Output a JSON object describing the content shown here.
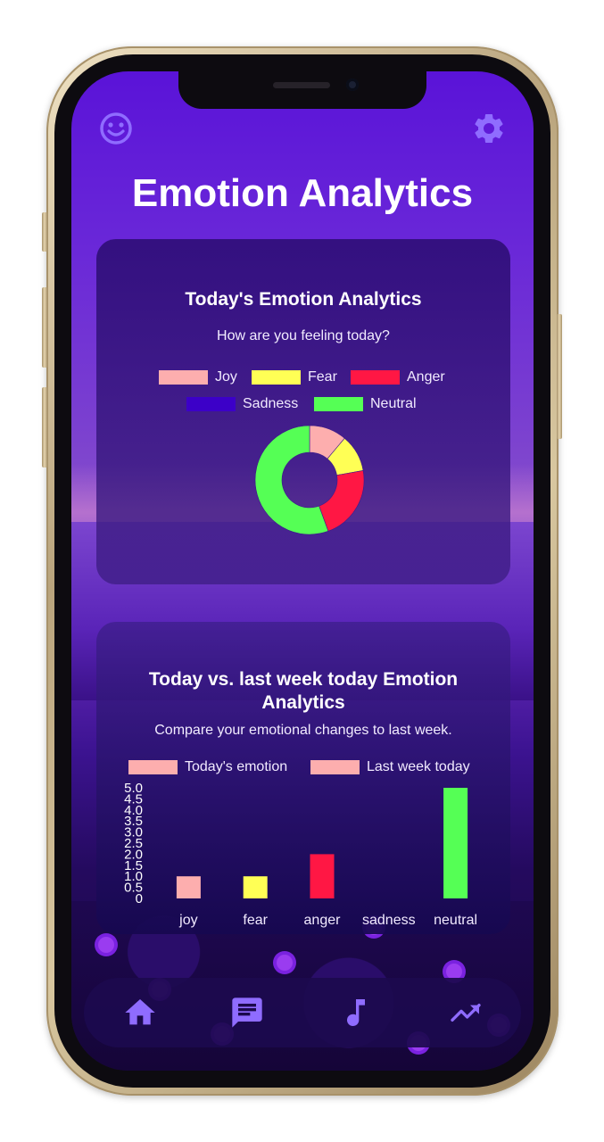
{
  "app": {
    "title": "Emotion Analytics",
    "top_left_icon": "smiley-face-icon",
    "top_right_icon": "gear-icon"
  },
  "card1": {
    "title": "Today's Emotion Analytics",
    "subtitle": "How are you feeling today?",
    "legend": [
      {
        "label": "Joy",
        "color": "#fdaeae"
      },
      {
        "label": "Fear",
        "color": "#ffff55"
      },
      {
        "label": "Anger",
        "color": "#ff1744"
      },
      {
        "label": "Sadness",
        "color": "#3c00c8"
      },
      {
        "label": "Neutral",
        "color": "#55ff55"
      }
    ]
  },
  "card2": {
    "title_line1": "Today vs. last week today Emotion",
    "title_line2": "Analytics",
    "subtitle": "Compare your emotional changes to last week.",
    "legend": [
      {
        "label": "Today's emotion",
        "color": "#fdaeae"
      },
      {
        "label": "Last week today",
        "color": "#fdaeae"
      }
    ]
  },
  "chart_data": [
    {
      "type": "pie",
      "categories": [
        "Joy",
        "Fear",
        "Anger",
        "Sadness",
        "Neutral"
      ],
      "values": [
        1,
        1,
        2,
        0,
        5
      ],
      "colors": [
        "#fdaeae",
        "#ffff55",
        "#ff1744",
        "#3c00c8",
        "#55ff55"
      ],
      "donut": true
    },
    {
      "type": "bar",
      "categories": [
        "joy",
        "fear",
        "anger",
        "sadness",
        "neutral"
      ],
      "series": [
        {
          "name": "Today's emotion",
          "values": [
            1,
            1,
            2,
            0,
            5
          ]
        }
      ],
      "bar_colors": [
        "#fdaeae",
        "#ffff55",
        "#ff1744",
        "#3c00c8",
        "#55ff55"
      ],
      "ylim": [
        0,
        5
      ],
      "yticks": [
        "0",
        "0.5",
        "1.0",
        "1.5",
        "2.0",
        "2.5",
        "3.0",
        "3.5",
        "4.0",
        "4.5",
        "5.0"
      ]
    }
  ],
  "nav": {
    "items": [
      {
        "name": "home",
        "icon": "home-icon"
      },
      {
        "name": "chat",
        "icon": "chat-icon"
      },
      {
        "name": "music",
        "icon": "music-note-icon"
      },
      {
        "name": "analytics",
        "icon": "trending-icon"
      }
    ]
  }
}
